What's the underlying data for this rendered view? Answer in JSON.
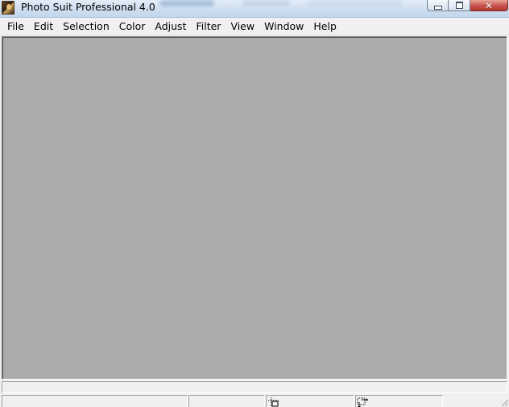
{
  "window": {
    "title": "Photo Suit Professional 4.0",
    "icon": "app-portrait-icon",
    "caption_buttons": [
      "minimize-icon",
      "maximize-icon",
      "close-icon"
    ]
  },
  "menubar": {
    "items": [
      {
        "label": "File"
      },
      {
        "label": "Edit"
      },
      {
        "label": "Selection"
      },
      {
        "label": "Color"
      },
      {
        "label": "Adjust"
      },
      {
        "label": "Filter"
      },
      {
        "label": "View"
      },
      {
        "label": "Window"
      },
      {
        "label": "Help"
      }
    ]
  },
  "workspace": {
    "background_color": "#ababab"
  },
  "statusbar": {
    "panels": [
      {
        "text": ""
      },
      {
        "text": ""
      },
      {
        "icon": "position-cursor-icon",
        "text": ""
      },
      {
        "icon": "selection-size-icon",
        "text": ""
      }
    ]
  }
}
